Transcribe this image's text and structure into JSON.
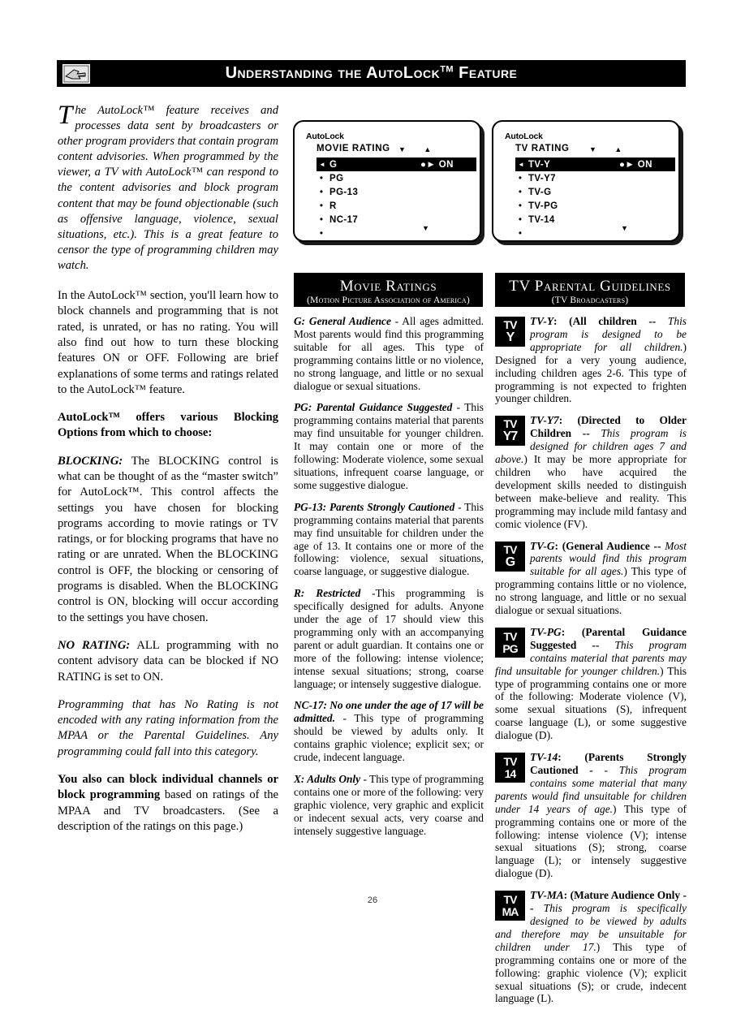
{
  "header": {
    "title_prefix": "Understanding the AutoLock",
    "title_tm": "TM",
    "title_suffix": "Feature",
    "icon_name": "tv-hand-pointer-icon"
  },
  "left_column": {
    "intro_dropcap": "T",
    "intro_text": "he AutoLock™ feature receives and processes data sent by broadcasters or other program providers that contain program content advisories. When programmed by the viewer, a TV with AutoLock™ can respond to the content advisories and block program content that may be found objectionable (such as offensive language, violence, sexual situations, etc.). This is a great feature to censor the type of programming children may watch.",
    "para_section": "In the AutoLock™ section, you'll learn how to block channels and programming that is not rated, is unrated, or has no rating. You will also find out how to turn these blocking features ON or OFF. Following are brief explanations of some terms and ratings related to the AutoLock™ feature.",
    "heading_options": "AutoLock™ offers various Blocking Options from which to choose:",
    "blocking_term": "BLOCKING:",
    "blocking_text": " The BLOCKING control is what can be thought of as the “master switch” for AutoLock™. This control affects the settings you have chosen for blocking programs according to movie ratings or TV ratings, or for blocking programs that have no rating or are unrated. When the BLOCKING control is OFF, the blocking or censoring of programs is disabled. When the BLOCKING control is ON, blocking will occur according to the settings you have chosen.",
    "norating_term": "NO RATING:",
    "norating_text": " ALL programming with no content advisory data can be blocked if NO RATING is set to ON.",
    "norating_italic": "Programming that has No Rating is not encoded with any rating information from the MPAA or the Parental Guidelines. Any programming could fall into this category.",
    "block_bold": "You also can block individual channels or block programming",
    "block_rest": " based on ratings of the MPAA and TV broadcasters. (See a description of the ratings on this page.)"
  },
  "screens": {
    "movie": {
      "title": "AutoLock",
      "subtitle": "MOVIE RATING",
      "arrows": "▼  ▲",
      "down_arrow": "▼",
      "rows": [
        {
          "label": "G",
          "value": "ON",
          "selected": true
        },
        {
          "label": "PG",
          "value": "",
          "selected": false
        },
        {
          "label": "PG-13",
          "value": "",
          "selected": false
        },
        {
          "label": "R",
          "value": "",
          "selected": false
        },
        {
          "label": "NC-17",
          "value": "",
          "selected": false
        },
        {
          "label": "",
          "value": "",
          "selected": false
        }
      ]
    },
    "tv": {
      "title": "AutoLock",
      "subtitle": "TV RATING",
      "arrows": "▼  ▲",
      "down_arrow": "▼",
      "rows": [
        {
          "label": "TV-Y",
          "value": "ON",
          "selected": true
        },
        {
          "label": "TV-Y7",
          "value": "",
          "selected": false
        },
        {
          "label": "TV-G",
          "value": "",
          "selected": false
        },
        {
          "label": "TV-PG",
          "value": "",
          "selected": false
        },
        {
          "label": "TV-14",
          "value": "",
          "selected": false
        },
        {
          "label": "",
          "value": "",
          "selected": false
        }
      ]
    }
  },
  "movie_section": {
    "banner_main": "Movie Ratings",
    "banner_sub": "(Motion Picture Association of America)",
    "ratings": [
      {
        "term": "G: General Audience",
        "text": " - All ages admitted. Most parents would find this programming suitable for all ages. This type of programming contains little or no violence, no strong language, and little or no sexual dialogue or sexual situations."
      },
      {
        "term": "PG: Parental Guidance Suggested",
        "text": " - This programming contains material that parents may find unsuitable for younger children. It may contain one or more of the following: Moderate violence, some sexual situations, infrequent coarse language, or some suggestive dialogue."
      },
      {
        "term": "PG-13: Parents Strongly Cautioned",
        "text": " - This programming contains material that parents may find unsuitable for children under the age of 13. It contains one or more of the following: violence, sexual situations, coarse language, or suggestive dialogue."
      },
      {
        "term": "R: Restricted",
        "text": " -This programming is specifically designed for adults.  Anyone under the age of 17 should view this programming only with an accompanying parent or adult guardian. It contains one or more of the following: intense violence; intense sexual situations; strong, coarse language; or intensely suggestive dialogue."
      },
      {
        "term": "NC-17: No one under the age of 17 will be admitted.",
        "text": " - This type of programming should be viewed by adults only. It contains graphic violence; explicit sex; or crude, indecent language."
      },
      {
        "term": "X: Adults Only",
        "text": " - This type of programming contains one or more of the following: very graphic violence, very graphic and explicit or indecent sexual acts, very coarse and intensely suggestive language."
      }
    ]
  },
  "tv_section": {
    "banner_main": "TV Parental Guidelines",
    "banner_sub": "(TV Broadcasters)",
    "ratings": [
      {
        "icon_top": "TV",
        "icon_bottom": "Y",
        "icon_name": "tv-y-rating-icon",
        "term": "TV-Y",
        "bold_part": ":  (All children -- ",
        "italic_part": "This program is designed to be appropriate for all children.",
        "text": ") Designed for a very young audience, including children ages 2-6. This type of programming is not expected to frighten younger children."
      },
      {
        "icon_top": "TV",
        "icon_bottom": "Y7",
        "icon_name": "tv-y7-rating-icon",
        "term": "TV-Y7",
        "bold_part": ":  (Directed to Older Children -- ",
        "italic_part": "This program is designed for children ages 7 and above.",
        "text": ") It may be more appropriate for children who have acquired the development skills needed to distinguish between make-believe and reality. This programming may include mild fantasy and comic violence (FV)."
      },
      {
        "icon_top": "TV",
        "icon_bottom": "G",
        "icon_name": "tv-g-rating-icon",
        "term": "TV-G",
        "bold_part": ":  (General Audience -- ",
        "italic_part": "Most parents would find this program suitable for all ages.",
        "text": ") This type of programming contains little or no violence, no strong language, and little or no sexual dialogue or sexual situations."
      },
      {
        "icon_top": "TV",
        "icon_bottom": "PG",
        "icon_name": "tv-pg-rating-icon",
        "term": "TV-PG",
        "bold_part": ":  (Parental Guidance Suggested -- ",
        "italic_part": "This program contains material that parents may find unsuitable for younger children.",
        "text": ") This type of programming contains one or more of the following: Moderate violence (V), some sexual situations (S), infrequent coarse language (L), or some suggestive dialogue (D)."
      },
      {
        "icon_top": "TV",
        "icon_bottom": "14",
        "icon_name": "tv-14-rating-icon",
        "term": "TV-14",
        "bold_part": ":  (Parents Strongly Cautioned - ",
        "italic_part": "- This program contains some material that many parents would find unsuitable for children under 14 years of age.",
        "text": ") This type of programming contains one or more of the following: intense violence (V); intense sexual situations (S); strong, coarse language (L); or intensely suggestive dialogue (D)."
      },
      {
        "icon_top": "TV",
        "icon_bottom": "MA",
        "icon_name": "tv-ma-rating-icon",
        "term": "TV-MA",
        "bold_part": ":  (Mature Audience Only -- ",
        "italic_part": "This program is specifically designed to be viewed by adults and therefore may be unsuitable for children under 17.",
        "text": ") This type of programming contains one or more of the following: graphic violence (V); explicit sexual situations (S); or crude, indecent language (L)."
      }
    ]
  },
  "footer": {
    "page_number": "26"
  }
}
